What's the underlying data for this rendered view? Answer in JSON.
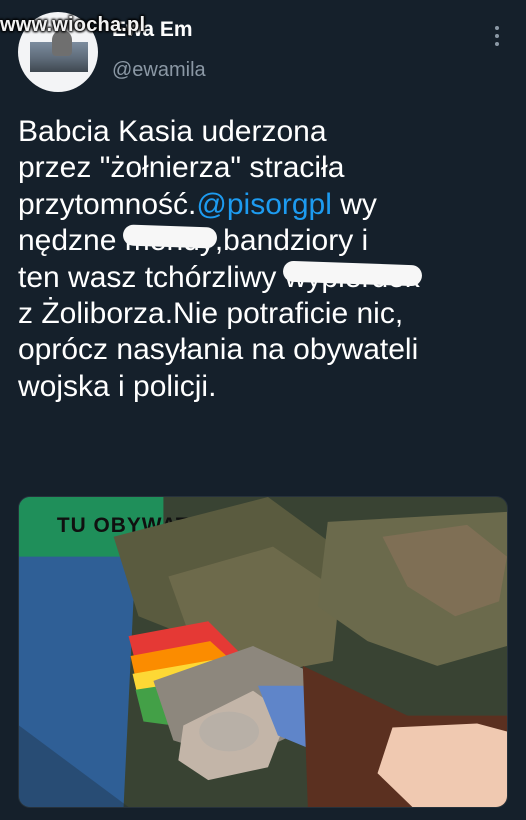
{
  "watermark": {
    "text": "www.wiocha.pl"
  },
  "author": {
    "display_name": "Ewa Em",
    "username": "@ewamila",
    "avatar_icon": "profile-avatar-image"
  },
  "menu": {
    "icon": "more-vertical-icon"
  },
  "tweet": {
    "line_1": "Babcia Kasia uderzona",
    "line_2": "przez \"żołnierza\" straciła",
    "line_3_prefix": "przytomność.",
    "line_3_mention": "@pisorgpl",
    "line_3_suffix": " wy",
    "line_4_prefix": "nędzne ",
    "line_4_censored": "mendy",
    "line_4_suffix": ",bandziory i",
    "line_5_prefix": "ten wasz tchórzliwy ",
    "line_5_censored": "wypierdek",
    "line_6": "z Żoliborza.Nie potraficie nic,",
    "line_7": "oprócz nasyłania na obywateli",
    "line_8": "wojska i policji."
  },
  "media": {
    "photo_caption_text": "TU OBYWATELE",
    "alt": "tweet-photo"
  },
  "colors": {
    "background": "#15202b",
    "text": "#ffffff",
    "muted": "#8b98a5",
    "mention": "#1d9bf0"
  }
}
